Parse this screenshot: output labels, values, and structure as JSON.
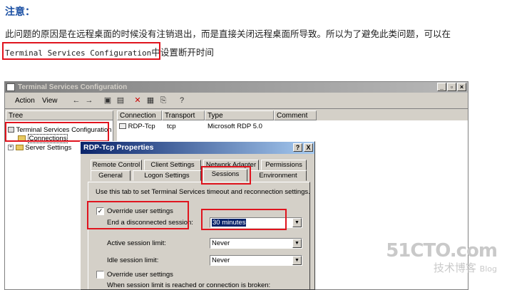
{
  "article": {
    "heading": "注意：",
    "line1": "此问题的原因是在远程桌面的时候没有注销退出，而是直接关闭远程桌面所导致。所以为了避免此类问题，可以在",
    "line2_code": "Terminal Services Configuration",
    "line2_rest": "中设置断开时间"
  },
  "window": {
    "title": "Terminal Services Configuration",
    "menu": {
      "action": "Action",
      "view": "View"
    },
    "tree_header": "Tree",
    "tree": {
      "root": "Terminal Services Configuration",
      "connections": "Connections",
      "server_settings": "Server Settings"
    },
    "columns": [
      "Connection",
      "Transport",
      "Type",
      "Comment"
    ],
    "row": {
      "connection": "RDP-Tcp",
      "transport": "tcp",
      "type": "Microsoft RDP 5.0",
      "comment": ""
    }
  },
  "dialog": {
    "title": "RDP-Tcp Properties",
    "help_btn": "?",
    "close_btn": "X",
    "tabs_row1": [
      "Remote Control",
      "Client Settings",
      "Network Adapter",
      "Permissions"
    ],
    "tabs_row2": [
      "General",
      "Logon Settings",
      "Sessions",
      "Environment"
    ],
    "active_tab": "Sessions",
    "intro": "Use this tab to set Terminal Services timeout and reconnection settings.",
    "override1": "Override user settings",
    "override1_checked": true,
    "end_disconnected_label": "End a disconnected session:",
    "end_disconnected_value": "30 minutes",
    "active_limit_label": "Active session limit:",
    "active_limit_value": "Never",
    "idle_limit_label": "Idle session limit:",
    "idle_limit_value": "Never",
    "override2": "Override user settings",
    "override2_checked": false,
    "broken_label": "When session limit is reached or connection is broken:"
  },
  "watermark": {
    "main": "51CTO.com",
    "sub": "技术博客",
    "blog": "Blog"
  },
  "colors": {
    "highlight": "#e0141e",
    "heading": "#1a4fa3",
    "dialog_title": "#0a246a"
  }
}
